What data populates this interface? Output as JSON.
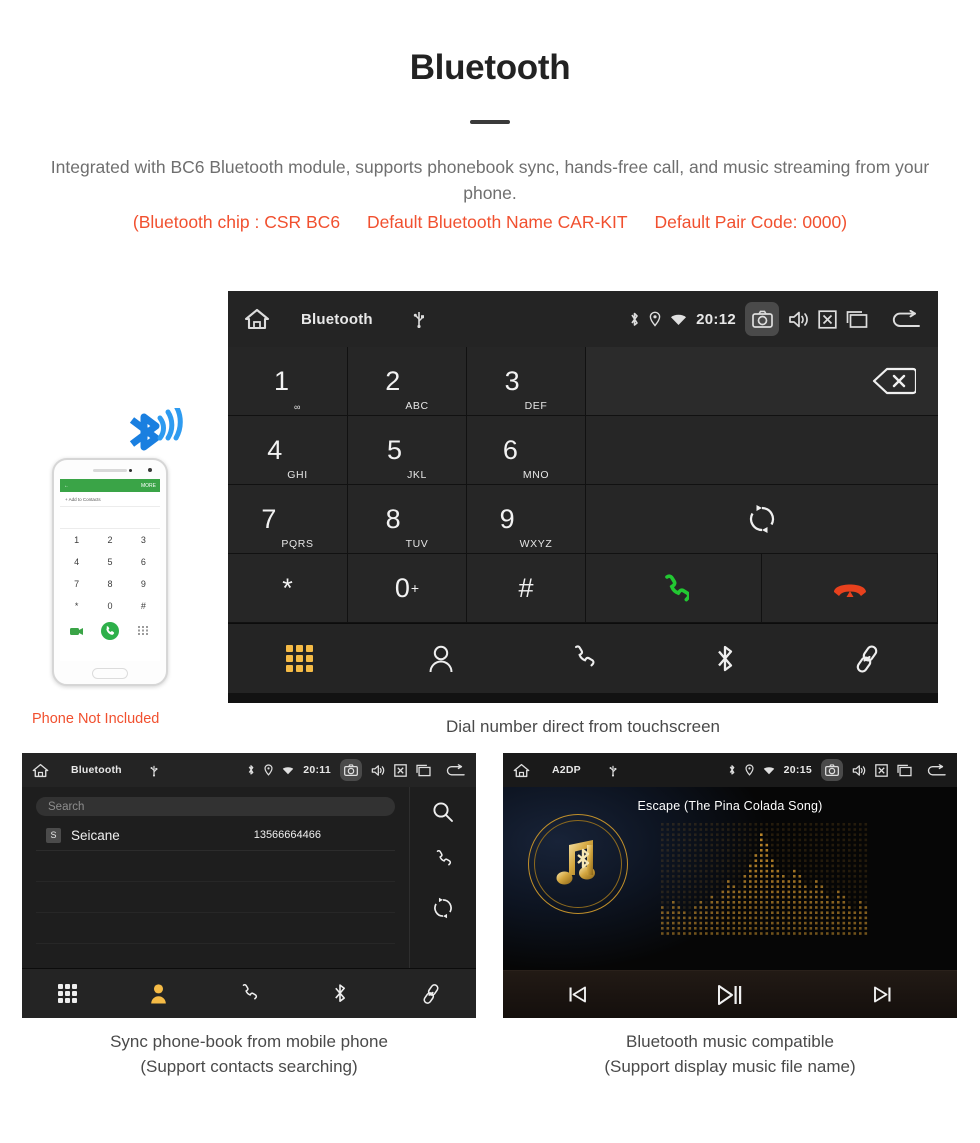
{
  "header": {
    "title": "Bluetooth",
    "intro": "Integrated with BC6 Bluetooth module, supports phonebook sync, hands-free call, and music streaming from your phone.",
    "spec_open": "(Bluetooth chip : CSR BC6",
    "spec_name": "Default Bluetooth Name CAR-KIT",
    "spec_pair": "Default Pair Code: 0000)"
  },
  "colors": {
    "accent_orange": "#f1502f",
    "tab_active_amber": "#f5bb46",
    "call_green": "#22c832",
    "hangup_red": "#e8411d",
    "gold": "#c08f2a",
    "screen_bg": "#262626"
  },
  "dialer": {
    "statusbar": {
      "home_icon": "home-icon",
      "title": "Bluetooth",
      "usb_icon": "usb-icon",
      "bluetooth_icon": "bluetooth-icon",
      "location_icon": "location-icon",
      "wifi_icon": "wifi-icon",
      "clock": "20:12",
      "camera_icon": "camera-icon",
      "volume_icon": "volume-icon",
      "close_icon": "close-box-icon",
      "recents_icon": "recents-icon",
      "back_icon": "back-icon"
    },
    "keys": [
      {
        "digit": "1",
        "letters": "∞",
        "letters_style": "oo"
      },
      {
        "digit": "2",
        "letters": "ABC"
      },
      {
        "digit": "3",
        "letters": "DEF"
      },
      {
        "digit": "4",
        "letters": "GHI"
      },
      {
        "digit": "5",
        "letters": "JKL"
      },
      {
        "digit": "6",
        "letters": "MNO"
      },
      {
        "digit": "7",
        "letters": "PQRS"
      },
      {
        "digit": "8",
        "letters": "TUV"
      },
      {
        "digit": "9",
        "letters": "WXYZ"
      },
      {
        "digit": "*",
        "letters": ""
      },
      {
        "digit": "0",
        "letters": "+"
      },
      {
        "digit": "#",
        "letters": ""
      }
    ],
    "backspace_icon": "backspace-icon",
    "sync_icon": "sync-icon",
    "call_icon": "call-icon",
    "hangup_icon": "hangup-icon",
    "tabs": [
      {
        "name": "dialpad",
        "icon": "dialpad-icon",
        "active": true
      },
      {
        "name": "contacts",
        "icon": "person-icon",
        "active": false
      },
      {
        "name": "call-log",
        "icon": "phone-icon",
        "active": false
      },
      {
        "name": "bluetooth",
        "icon": "bluetooth-icon",
        "active": false
      },
      {
        "name": "pair-link",
        "icon": "link-icon",
        "active": false
      }
    ],
    "caption": "Dial number direct from touchscreen"
  },
  "phonebook": {
    "statusbar": {
      "title": "Bluetooth",
      "clock": "20:11"
    },
    "search": {
      "placeholder": "Search",
      "value": ""
    },
    "contacts": [
      {
        "initial": "S",
        "name": "Seicane",
        "number": "13566664466"
      }
    ],
    "side_actions": [
      {
        "name": "search",
        "icon": "search-icon"
      },
      {
        "name": "dial",
        "icon": "phone-icon"
      },
      {
        "name": "sync",
        "icon": "sync-icon"
      }
    ],
    "tabs": [
      {
        "name": "dialpad",
        "icon": "dialpad-icon",
        "active": false
      },
      {
        "name": "contacts",
        "icon": "person-icon",
        "active": true
      },
      {
        "name": "call-log",
        "icon": "phone-icon",
        "active": false
      },
      {
        "name": "bluetooth",
        "icon": "bluetooth-icon",
        "active": false
      },
      {
        "name": "pair-link",
        "icon": "link-icon",
        "active": false
      }
    ],
    "caption_line1": "Sync phone-book from mobile phone",
    "caption_line2": "(Support contacts searching)"
  },
  "music": {
    "statusbar": {
      "title": "A2DP",
      "clock": "20:15"
    },
    "song_title": "Escape (The Pina Colada Song)",
    "album_icon": "music-note-bluetooth-icon",
    "controls": [
      {
        "name": "previous",
        "icon": "previous-track-icon"
      },
      {
        "name": "play-pause",
        "icon": "play-pause-icon"
      },
      {
        "name": "next",
        "icon": "next-track-icon"
      }
    ],
    "caption_line1": "Bluetooth music compatible",
    "caption_line2": "(Support display music file name)"
  },
  "phone_mock": {
    "appbar_back": "←",
    "appbar_more": "MORE",
    "add_contact": "+   Add to Contacts",
    "keys": [
      "1",
      "2",
      "3",
      "4",
      "5",
      "6",
      "7",
      "8",
      "9",
      "*",
      "0",
      "#"
    ],
    "note": "Phone Not Included"
  }
}
